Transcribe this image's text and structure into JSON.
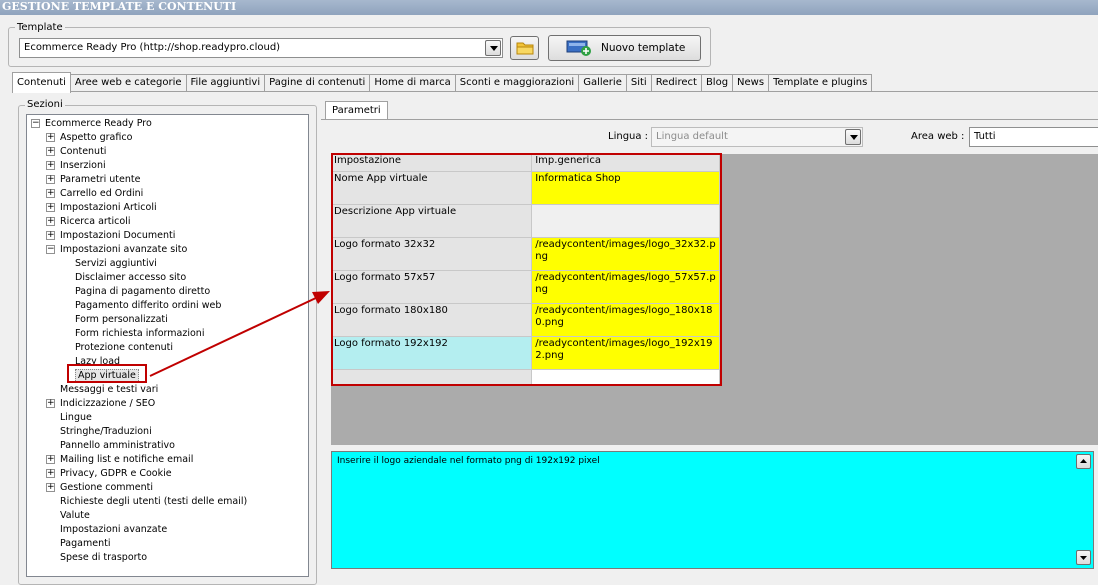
{
  "window": {
    "title": "GESTIONE TEMPLATE E CONTENUTI"
  },
  "template_group": {
    "legend": "Template",
    "selected": "Ecommerce Ready Pro (http://shop.readypro.cloud)",
    "new_button_label": "Nuovo template"
  },
  "tabs": [
    {
      "label": "Contenuti",
      "active": true
    },
    {
      "label": "Aree web e categorie"
    },
    {
      "label": "File aggiuntivi"
    },
    {
      "label": "Pagine di contenuti"
    },
    {
      "label": "Home di marca"
    },
    {
      "label": "Sconti e maggiorazioni"
    },
    {
      "label": "Gallerie"
    },
    {
      "label": "Siti"
    },
    {
      "label": "Redirect"
    },
    {
      "label": "Blog"
    },
    {
      "label": "News"
    },
    {
      "label": "Template e plugins"
    }
  ],
  "sections": {
    "legend": "Sezioni",
    "root": "Ecommerce Ready Pro",
    "items": [
      {
        "label": "Aspetto grafico",
        "expander": "+"
      },
      {
        "label": "Contenuti",
        "expander": "+"
      },
      {
        "label": "Inserzioni",
        "expander": "+"
      },
      {
        "label": "Parametri utente",
        "expander": "+"
      },
      {
        "label": "Carrello ed Ordini",
        "expander": "+"
      },
      {
        "label": "Impostazioni Articoli",
        "expander": "+"
      },
      {
        "label": "Ricerca articoli",
        "expander": "+"
      },
      {
        "label": "Impostazioni Documenti",
        "expander": "+"
      },
      {
        "label": "Impostazioni avanzate sito",
        "expander": "-"
      },
      {
        "label": "Servizi aggiuntivi",
        "child": true
      },
      {
        "label": "Disclaimer accesso sito",
        "child": true
      },
      {
        "label": "Pagina di pagamento diretto",
        "child": true
      },
      {
        "label": "Pagamento differito ordini web",
        "child": true
      },
      {
        "label": "Form personalizzati",
        "child": true
      },
      {
        "label": "Form richiesta informazioni",
        "child": true
      },
      {
        "label": "Protezione contenuti",
        "child": true
      },
      {
        "label": "Lazy load",
        "child": true
      },
      {
        "label": "App virtuale",
        "child": true,
        "selected": true
      },
      {
        "label": "Messaggi e testi vari"
      },
      {
        "label": "Indicizzazione / SEO",
        "expander": "+"
      },
      {
        "label": "Lingue"
      },
      {
        "label": "Stringhe/Traduzioni"
      },
      {
        "label": "Pannello amministrativo"
      },
      {
        "label": "Mailing list e notifiche email",
        "expander": "+"
      },
      {
        "label": "Privacy, GDPR e Cookie",
        "expander": "+"
      },
      {
        "label": "Gestione commenti",
        "expander": "+"
      },
      {
        "label": "Richieste degli utenti (testi delle email)"
      },
      {
        "label": "Valute"
      },
      {
        "label": "Impostazioni avanzate"
      },
      {
        "label": "Pagamenti"
      },
      {
        "label": "Spese di trasporto"
      }
    ]
  },
  "params": {
    "tab_label": "Parametri",
    "language_label": "Lingua :",
    "language_value": "Lingua default",
    "area_label": "Area web :",
    "area_value": "Tutti",
    "headers": [
      "Impostazione",
      "Imp.generica"
    ],
    "rows": [
      {
        "name": "Nome App virtuale",
        "value": "Informatica Shop",
        "highlight": true
      },
      {
        "name": "Descrizione App virtuale",
        "value": ""
      },
      {
        "name": "Logo formato 32x32",
        "value": "/readycontent/images/logo_32x32.png",
        "highlight": true
      },
      {
        "name": "Logo formato 57x57",
        "value": "/readycontent/images/logo_57x57.png",
        "highlight": true
      },
      {
        "name": "Logo formato 180x180",
        "value": "/readycontent/images/logo_180x180.png",
        "highlight": true
      },
      {
        "name": "Logo formato 192x192",
        "value": "/readycontent/images/logo_192x192.png",
        "highlight": true,
        "selected": true
      }
    ],
    "description": "Inserire il logo aziendale nel formato png di 192x192 pixel"
  },
  "colors": {
    "highlight": "#ffff00",
    "selected_row": "#b4eef0",
    "description_bg": "#00ffff",
    "annotation": "#c00000"
  }
}
